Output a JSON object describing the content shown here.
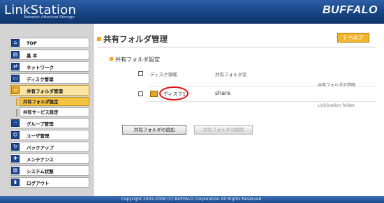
{
  "header": {
    "logo": "LinkStation",
    "logo_sub": "Network Attached Storage",
    "brand": "BUFFALO"
  },
  "sidebar": {
    "items": [
      {
        "label": "TOP",
        "icon": "home-icon"
      },
      {
        "label": "基 本",
        "icon": "basic-settings-icon"
      },
      {
        "label": "ネットワーク",
        "icon": "network-icon"
      },
      {
        "label": "ディスク管理",
        "icon": "disk-icon"
      },
      {
        "label": "共有フォルダ管理",
        "icon": "folder-icon",
        "active": true
      },
      {
        "label": "共有フォルダ設定",
        "sub": true,
        "selected": true
      },
      {
        "label": "共有サービス設定",
        "sub": true
      },
      {
        "label": "グループ管理",
        "icon": "group-icon"
      },
      {
        "label": "ユーザ管理",
        "icon": "user-icon"
      },
      {
        "label": "バックアップ",
        "icon": "backup-icon"
      },
      {
        "label": "メンテナンス",
        "icon": "maintenance-icon"
      },
      {
        "label": "システム状態",
        "icon": "system-status-icon"
      },
      {
        "label": "ログアウト",
        "icon": "logout-icon"
      }
    ]
  },
  "main": {
    "title": "共有フォルダ管理",
    "help_label": "？ヘルプ",
    "section_title": "共有フォルダ設定",
    "table": {
      "header_disk": "ディスク領域",
      "header_share": "共有フォルダ名",
      "header_desc": "共有フォルダの説明",
      "rows": [
        {
          "disk": "ディスク1",
          "share": "share",
          "description": "LinkStation folder"
        }
      ]
    },
    "add_button": "共有フォルダの追加",
    "delete_button": "共有フォルダの削除"
  },
  "footer": {
    "copyright": "Copyright 2002-2006 (C) BUFFALO Corporation All Rights Reserved."
  },
  "colors": {
    "header_blue": "#164381",
    "accent_orange": "#f1a626",
    "highlight_red": "#e01010"
  }
}
